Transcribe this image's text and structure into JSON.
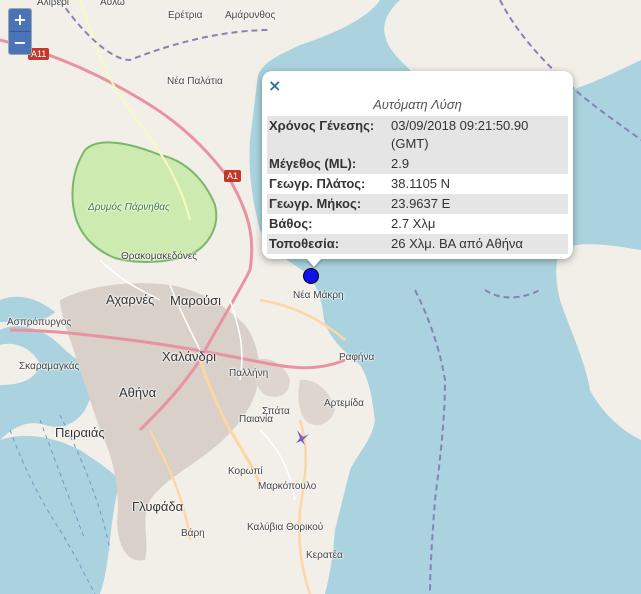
{
  "zoom": {
    "in_label": "+",
    "out_label": "−"
  },
  "popup": {
    "close_label": "×",
    "title": "Αυτόματη Λύση",
    "rows": [
      {
        "key": "Χρόνος Γένεσης:",
        "value": "03/09/2018 09:21:50.90 (GMT)"
      },
      {
        "key": "Μέγεθος (ML):",
        "value": "2.9"
      },
      {
        "key": "Γεωγρ. Πλάτος:",
        "value": "38.1105 N"
      },
      {
        "key": "Γεωγρ. Μήκος:",
        "value": "23.9637 E"
      },
      {
        "key": "Βάθος:",
        "value": "2.7 Χλμ"
      },
      {
        "key": "Τοποθεσία:",
        "value": "26 Χλμ. ΒΑ από Αθήνα"
      }
    ]
  },
  "map": {
    "colors": {
      "land": "#f2efe9",
      "sea": "#aad3df",
      "park": "#cdebb0",
      "urban": "#d9d0c9",
      "marker": "#1010ee"
    },
    "places": {
      "aliveri": "Αλιβερι",
      "avlo": "Αυλώ",
      "eretria": "Ερέτρια",
      "amarynthos": "Αμάρυνθος",
      "nea_palatia": "Νέα Παλάτια",
      "park": "Δρυμός Πάρνηθας",
      "thrakomakedones": "Θρακομακεδόνες",
      "acharnes": "Αχαρνές",
      "marousi": "Μαρούσι",
      "aspropyrgos": "Ασπρόπυργος",
      "chalandri": "Χαλάνδρι",
      "nea_makri": "Νέα Μάκρη",
      "rafina": "Ραφήνα",
      "skaramagkas": "Σκαραμαγκάς",
      "pallini": "Παλλήνη",
      "athina": "Αθήνα",
      "artemida": "Αρτεμίδα",
      "peiraias": "Πειραιάς",
      "paiania": "Παιανία",
      "spata": "Σπάτα",
      "koropi": "Κορωπί",
      "markopoulo": "Μαρκόπουλο",
      "glyfada": "Γλυφάδα",
      "vari": "Βάρη",
      "kalyvia": "Καλύβια Θορικού",
      "keratea": "Κερατέα"
    },
    "road_a11": "A11",
    "road_a1": "A1"
  }
}
